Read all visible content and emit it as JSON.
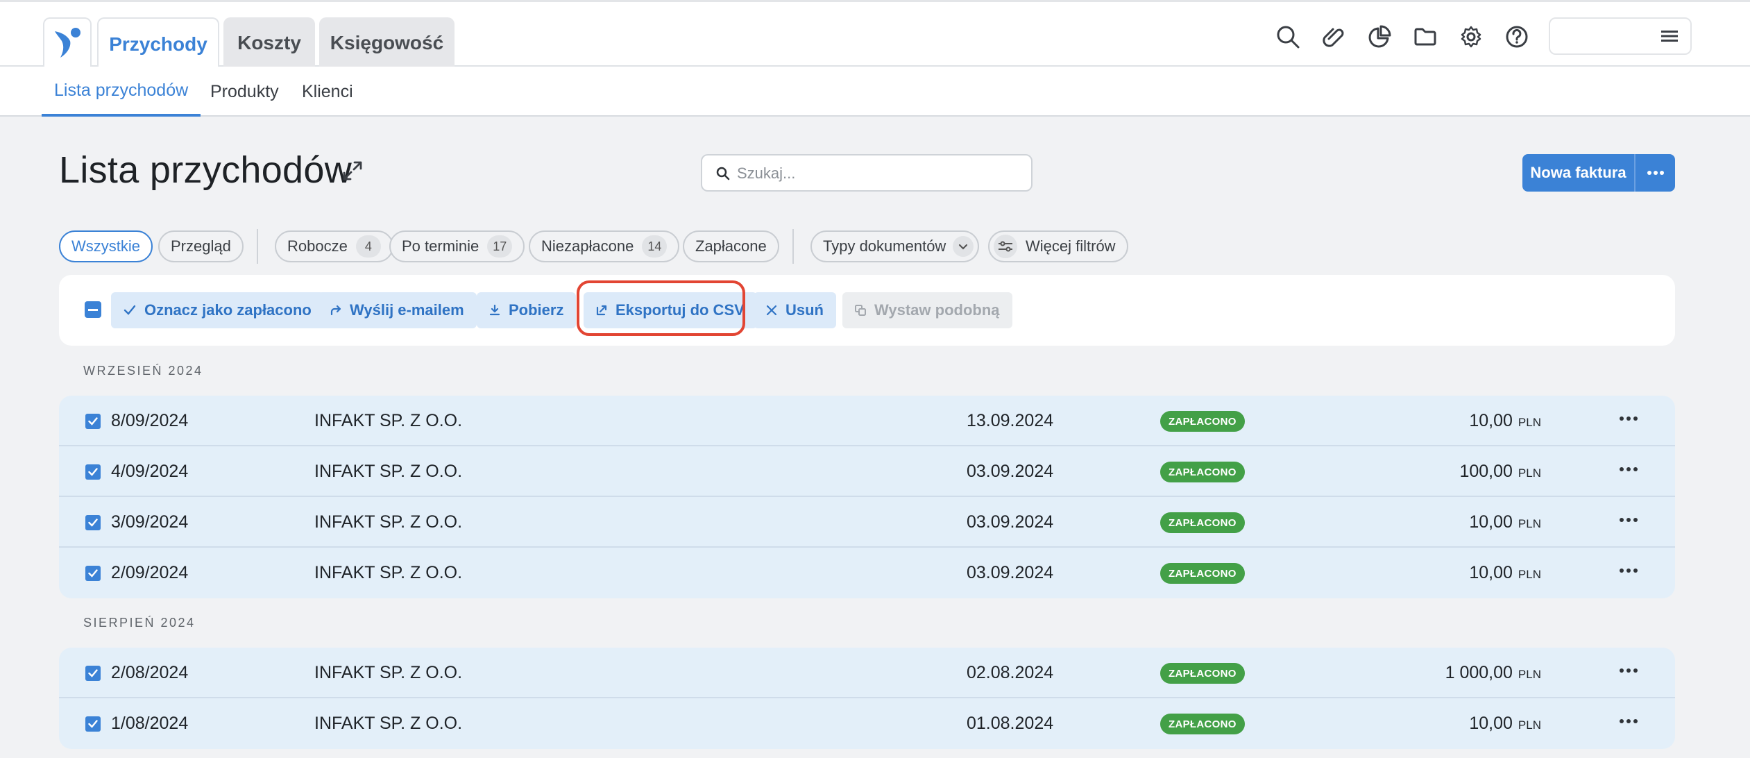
{
  "app": {
    "logo_icon": "bird-logo-icon"
  },
  "top_tabs": [
    {
      "label": "Przychody",
      "active": true
    },
    {
      "label": "Koszty",
      "active": false
    },
    {
      "label": "Księgowość",
      "active": false
    }
  ],
  "top_icons": [
    "search-icon",
    "paperclip-icon",
    "pie-chart-icon",
    "folder-icon",
    "gear-icon",
    "help-icon",
    "hamburger-icon"
  ],
  "sub_tabs": [
    {
      "label": "Lista przychodów",
      "active": true
    },
    {
      "label": "Produkty",
      "active": false
    },
    {
      "label": "Klienci",
      "active": false
    }
  ],
  "page": {
    "title": "Lista przychodów",
    "search_placeholder": "Szukaj...",
    "new_invoice_label": "Nowa faktura"
  },
  "filters": {
    "all": "Wszystkie",
    "overview": "Przegląd",
    "draft": {
      "label": "Robocze",
      "count": "4"
    },
    "overdue": {
      "label": "Po terminie",
      "count": "17"
    },
    "unpaid": {
      "label": "Niezapłacone",
      "count": "14"
    },
    "paid": "Zapłacone",
    "doc_types": "Typy dokumentów",
    "more_filters": "Więcej filtrów"
  },
  "actions": {
    "mark_paid": "Oznacz jako zapłacono",
    "send_email": "Wyślij e-mailem",
    "download": "Pobierz",
    "export_csv": "Eksportuj do CSV",
    "delete": "Usuń",
    "issue_similar": "Wystaw podobną"
  },
  "groups": [
    {
      "label": "WRZESIEŃ 2024",
      "rows": [
        {
          "number": "8/09/2024",
          "client": "INFAKT SP. Z O.O.",
          "date": "13.09.2024",
          "status": "ZAPŁACONO",
          "amount": "10,00",
          "currency": "PLN"
        },
        {
          "number": "4/09/2024",
          "client": "INFAKT SP. Z O.O.",
          "date": "03.09.2024",
          "status": "ZAPŁACONO",
          "amount": "100,00",
          "currency": "PLN"
        },
        {
          "number": "3/09/2024",
          "client": "INFAKT SP. Z O.O.",
          "date": "03.09.2024",
          "status": "ZAPŁACONO",
          "amount": "10,00",
          "currency": "PLN"
        },
        {
          "number": "2/09/2024",
          "client": "INFAKT SP. Z O.O.",
          "date": "03.09.2024",
          "status": "ZAPŁACONO",
          "amount": "10,00",
          "currency": "PLN"
        }
      ]
    },
    {
      "label": "SIERPIEŃ 2024",
      "rows": [
        {
          "number": "2/08/2024",
          "client": "INFAKT SP. Z O.O.",
          "date": "02.08.2024",
          "status": "ZAPŁACONO",
          "amount": "1 000,00",
          "currency": "PLN"
        },
        {
          "number": "1/08/2024",
          "client": "INFAKT SP. Z O.O.",
          "date": "01.08.2024",
          "status": "ZAPŁACONO",
          "amount": "10,00",
          "currency": "PLN"
        }
      ]
    }
  ],
  "colors": {
    "accent": "#3b82d6",
    "paid_badge": "#43a047",
    "highlight": "#e24533",
    "row_bg": "#e3eff9"
  }
}
